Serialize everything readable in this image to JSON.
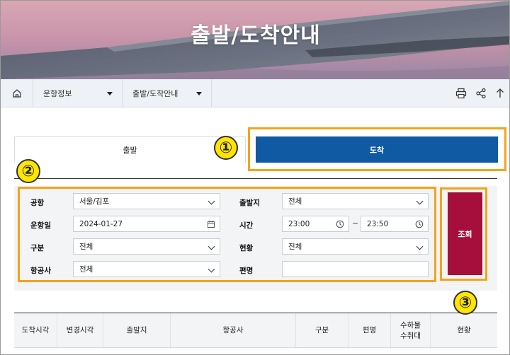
{
  "page": {
    "title": "출발/도착안내"
  },
  "navbar": {
    "home_icon": "home-icon",
    "dropdown1": "운항정보",
    "dropdown2": "출발/도착안내",
    "tools": [
      "print-icon",
      "share-icon",
      "arrow-up-icon"
    ]
  },
  "tabs": {
    "depart": "출발",
    "arrive": "도착",
    "active": "arrive"
  },
  "annotations": {
    "n1": "①",
    "n2": "②",
    "n3": "③",
    "color": "#f5a31a"
  },
  "search": {
    "airport_label": "공항",
    "airport_value": "서울/김포",
    "origin_label": "출발지",
    "origin_value": "전체",
    "date_label": "운항일",
    "date_value": "2024-01-27",
    "time_label": "시간",
    "time_from": "23:00",
    "time_sep": "~",
    "time_to": "23:50",
    "type_label": "구분",
    "type_value": "전체",
    "status_label": "현황",
    "status_value": "전체",
    "airline_label": "항공사",
    "airline_value": "전체",
    "flight_label": "편명",
    "flight_value": "",
    "search_button": "조회",
    "button_color": "#a60f3b"
  },
  "table": {
    "columns": [
      "도착시각",
      "변경시각",
      "출발지",
      "항공사",
      "구분",
      "편명",
      "수하물\n수취대",
      "현황"
    ]
  },
  "colors": {
    "primary": "#0f5aa3",
    "accent": "#a60f3b",
    "annotation": "#f5a31a"
  }
}
